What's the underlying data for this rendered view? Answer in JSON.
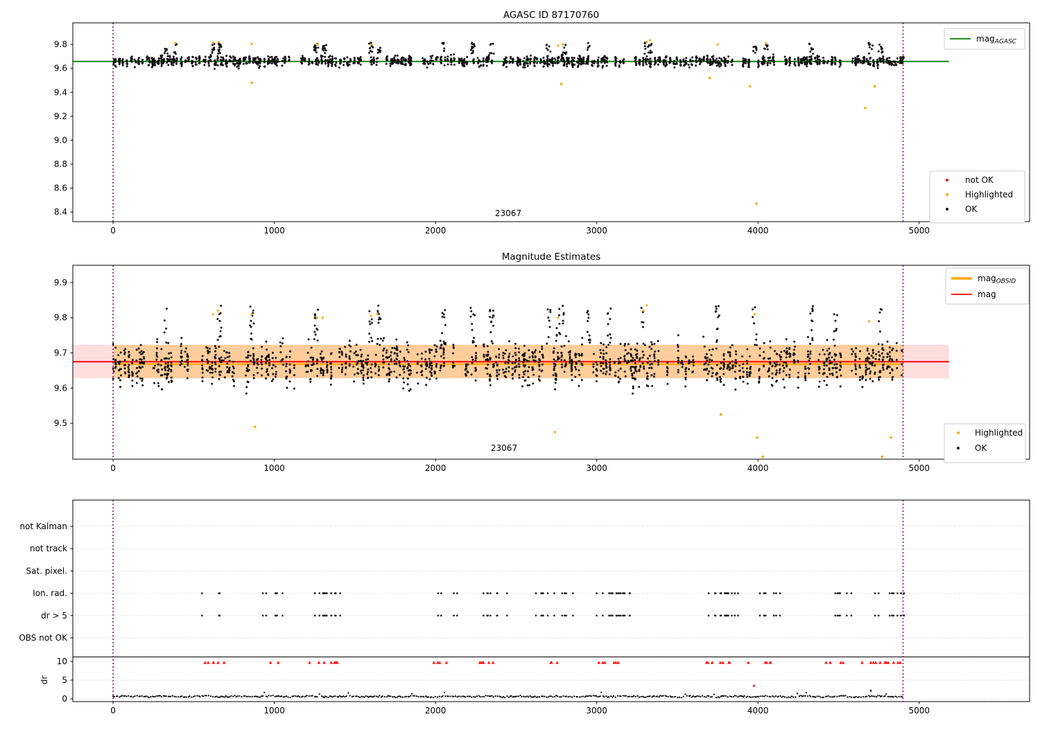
{
  "figure": {
    "background": "#ffffff"
  },
  "colors": {
    "scatter_ok": "#111111",
    "not_ok": "#ff0000",
    "highlighted": "#ffa500",
    "mag_agasc_line": "#008000",
    "mag_line": "#ff0000",
    "mag_obsid_line": "#ffa500",
    "obsid_boundary": "#800080",
    "grid": "#c9c9c9",
    "legend_border": "#cccccc",
    "separator": "#000000"
  },
  "chart_data": [
    {
      "type": "scatter",
      "title": "AGASC ID 87170760",
      "xlim": [
        -250,
        5685
      ],
      "ylim": [
        8.32,
        9.98
      ],
      "xticks": [
        0,
        1000,
        2000,
        3000,
        4000,
        5000
      ],
      "yticks": [
        9.8,
        9.6,
        9.4,
        9.2,
        9.0,
        8.8,
        8.6,
        8.4
      ],
      "annotation": {
        "text": "23067",
        "x": 2450,
        "y": 8.37
      },
      "obsid_boundaries": [
        0,
        4900
      ],
      "ref_line": {
        "label_main": "mag",
        "label_sub": "AGASC",
        "y": 9.658,
        "x_start": -250,
        "x_end": 5185,
        "color": "#008000"
      },
      "legend_markers": [
        {
          "label": "not OK",
          "color": "#ff0000"
        },
        {
          "label": "Highlighted",
          "color": "#ffa500"
        },
        {
          "label": "OK",
          "color": "#111111"
        }
      ],
      "scatter": {
        "x_start": 0,
        "x_end": 4900,
        "base_center": 9.66,
        "base_wander": 0.018,
        "base_sigma": 0.02,
        "y_min": 9.595,
        "y_max": 9.74,
        "burst_centers": [
          330,
          385,
          620,
          660,
          860,
          1260,
          1310,
          1600,
          1650,
          2050,
          2230,
          2350,
          2700,
          2760,
          2800,
          2950,
          3080,
          3290,
          3330,
          3750,
          3980,
          4050,
          4330,
          4480,
          4700,
          4760
        ],
        "burst_y": [
          9.72,
          9.815
        ],
        "seed": 42
      },
      "highlighted_points": [
        [
          385,
          9.81
        ],
        [
          620,
          9.815
        ],
        [
          655,
          9.82
        ],
        [
          860,
          9.805
        ],
        [
          1270,
          9.8
        ],
        [
          1600,
          9.8
        ],
        [
          2760,
          9.79
        ],
        [
          2790,
          9.8
        ],
        [
          3310,
          9.82
        ],
        [
          3330,
          9.835
        ],
        [
          3750,
          9.8
        ],
        [
          4050,
          9.81
        ]
      ],
      "highlighted_outliers": [
        [
          860,
          9.48
        ],
        [
          2780,
          9.47
        ],
        [
          3700,
          9.52
        ],
        [
          3950,
          9.45
        ],
        [
          3990,
          8.47
        ],
        [
          4665,
          9.27
        ],
        [
          4725,
          9.45
        ]
      ]
    },
    {
      "type": "scatter",
      "title": "Magnitude Estimates",
      "xlim": [
        -250,
        5685
      ],
      "ylim": [
        9.398,
        9.949
      ],
      "xticks": [
        0,
        1000,
        2000,
        3000,
        4000,
        5000
      ],
      "yticks": [
        9.9,
        9.8,
        9.7,
        9.6,
        9.5
      ],
      "annotation": {
        "text": "23067",
        "x": 2420,
        "y": 9.425
      },
      "obsid_boundaries": [
        0,
        4900
      ],
      "mag_line": {
        "label_main": "mag",
        "label_sub": "",
        "y": 9.675,
        "x_start": -250,
        "x_end": 5185,
        "color": "#ff0000",
        "band": [
          9.628,
          9.723
        ]
      },
      "obsid_line": {
        "label_main": "mag",
        "label_sub": "OBSID",
        "y": 9.6705,
        "x_start": 0,
        "x_end": 4900,
        "color": "#ffa500"
      },
      "legend_markers": [
        {
          "label": "Highlighted",
          "color": "#ffa500"
        },
        {
          "label": "OK",
          "color": "#111111"
        }
      ],
      "scatter": {
        "x_start": 0,
        "x_end": 4900,
        "base_center": 9.668,
        "base_wander": 0.03,
        "base_sigma": 0.026,
        "y_min": 9.575,
        "y_max": 9.77,
        "burst_centers": [
          330,
          385,
          620,
          660,
          860,
          1260,
          1310,
          1600,
          1650,
          2050,
          2230,
          2350,
          2700,
          2760,
          2800,
          2950,
          3080,
          3290,
          3330,
          3750,
          3980,
          4050,
          4330,
          4480,
          4700,
          4760
        ],
        "burst_y": [
          9.72,
          9.835
        ],
        "seed": 77
      },
      "highlighted_points": [
        [
          620,
          9.81
        ],
        [
          650,
          9.82
        ],
        [
          860,
          9.81
        ],
        [
          1265,
          9.8
        ],
        [
          1300,
          9.8
        ],
        [
          1600,
          9.805
        ],
        [
          1640,
          9.81
        ],
        [
          2760,
          9.8
        ],
        [
          3290,
          9.82
        ],
        [
          3310,
          9.835
        ],
        [
          3980,
          9.81
        ],
        [
          4690,
          9.79
        ]
      ],
      "highlighted_outliers": [
        [
          880,
          9.49
        ],
        [
          2740,
          9.475
        ],
        [
          3770,
          9.525
        ],
        [
          3995,
          9.46
        ],
        [
          4030,
          9.405
        ],
        [
          4770,
          9.405
        ],
        [
          4825,
          9.46
        ]
      ]
    },
    {
      "type": "flags-and-dr",
      "xlim": [
        -250,
        5685
      ],
      "xticks": [
        0,
        1000,
        2000,
        3000,
        4000,
        5000
      ],
      "ylabel": "dr",
      "flag_labels": [
        "not Kalman",
        "not track",
        "Sat. pixel.",
        "Ion. rad.",
        "dr > 5",
        "OBS not OK"
      ],
      "flag_rows_with_data": [
        "Ion. rad.",
        "dr > 5"
      ],
      "dr_ticks": [
        10,
        5,
        0
      ],
      "obsid_boundaries": [
        0,
        4900
      ],
      "flag_groups_x": [
        607,
        986,
        1285,
        1320,
        1350,
        2082,
        2327,
        2373,
        2650,
        2786,
        3074,
        3100,
        3135,
        3761,
        3800,
        3827,
        4084,
        4557,
        4781,
        4836
      ],
      "dr_clipped_x": [
        600,
        640,
        986,
        1270,
        1300,
        1340,
        2030,
        2290,
        2330,
        2700,
        2780,
        3060,
        3095,
        3130,
        3720,
        3770,
        3990,
        4030,
        4065,
        4470,
        4700,
        4740,
        4790,
        4830
      ],
      "dr_clip_y": 9.7,
      "dr_red_outliers": [
        [
          3975,
          3.5
        ]
      ],
      "dr_black_outliers": [
        [
          4700,
          2.2
        ]
      ],
      "dr_trace": {
        "x_start": 0,
        "x_end": 4900,
        "base": 0.3,
        "amp": 0.55,
        "seed": 9
      }
    }
  ]
}
